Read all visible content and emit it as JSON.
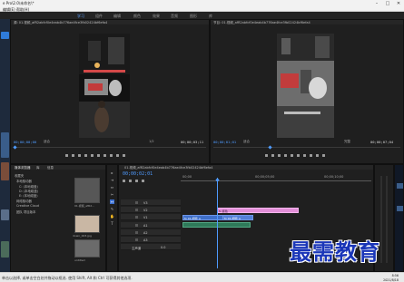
{
  "window": {
    "title": "e Pro\\2.0\\未命名\\*",
    "menu": [
      "编辑(E)",
      "帮助(H)"
    ]
  },
  "workspaces": {
    "tabs": [
      "学习",
      "组件",
      "编辑",
      "颜色",
      "效果",
      "音频",
      "图形",
      "库"
    ],
    "active_index": 0
  },
  "source_monitor": {
    "title": "源: 01.视频_afR2abfcf0e4eab4b776ae4fce3fb02424bf6efa4",
    "timecode_in": "00;00;00;00",
    "zoom": "适合",
    "fraction": "1/2",
    "timecode_out": "00;00;03;11"
  },
  "program_monitor": {
    "title": "节目: 01.视频_afR2abfcf0e4eab4b776ae4fce3fb02424bf6efa4",
    "timecode_in": "00;00;01;01",
    "zoom": "适合",
    "quality": "完整",
    "timecode_out": "00;00;07;04"
  },
  "project_panel": {
    "tabs": [
      "媒体浏览器",
      "库",
      "信息"
    ],
    "tree": [
      "收藏夹",
      "本地驱动器",
      "C: (本地磁盘)",
      "D: (本地磁盘)",
      "E: (本地磁盘)",
      "网络驱动器",
      "Creative Cloud",
      "团队 项目版本"
    ],
    "thumbs": [
      {
        "label": "01.视频_afR2..."
      },
      {
        "label": "down_003.jpg"
      },
      {
        "label": "untitled"
      }
    ]
  },
  "timeline": {
    "title": "01.视频_afR2abfcf0e4eab4b776ae4fce3fb02424bf6efa4",
    "timecode": "00;00;02;01",
    "ruler": [
      "00;00",
      "00;00;05;00",
      "00;00;10;00"
    ],
    "tracks": [
      {
        "name": "V3"
      },
      {
        "name": "V2"
      },
      {
        "name": "V1"
      },
      {
        "name": "A1"
      },
      {
        "name": "A2"
      },
      {
        "name": "A3"
      },
      {
        "name": "主声道"
      }
    ],
    "clips": {
      "pink_label": "fx 颜色",
      "v1_a": "fx 01.视频_a",
      "v1_b": "fx 01.视频_a"
    },
    "master_value": "0.0"
  },
  "taskbar": {
    "status": "单击以选择, 或单击空白处并拖动以框选. 使用 Shift, Alt 和 Ctrl 可获得其他选项.",
    "time": "8:56",
    "date": "2021/8/18"
  },
  "watermark": "最需教育",
  "colors": {
    "accent": "#4f9bff",
    "clip_video": "#3f6fc9",
    "clip_pink": "#e28fd8",
    "watermark": "#1a36b8"
  }
}
